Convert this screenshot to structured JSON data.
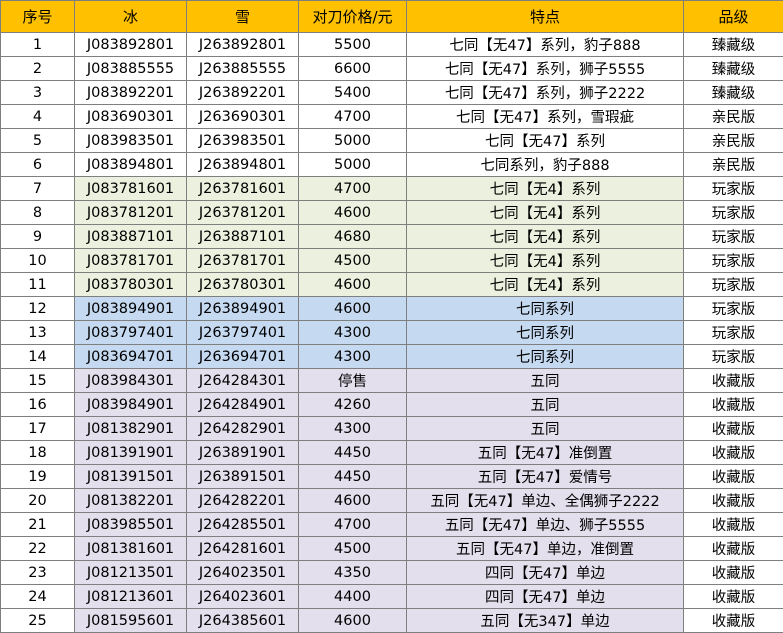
{
  "headers": [
    "序号",
    "冰",
    "雪",
    "对刀价格/元",
    "特点",
    "品级"
  ],
  "colors": {
    "header": "#ffc000",
    "default": "#ffffff",
    "green": "#ebf1de",
    "blue": "#c5d9f1",
    "purple": "#e4dfec"
  },
  "rows": [
    {
      "no": "1",
      "ice": "J083892801",
      "snow": "J263892801",
      "price": "5500",
      "feature": "七同【无47】系列，豹子888",
      "grade": "臻藏级",
      "fill": "default",
      "fill_mid": true
    },
    {
      "no": "2",
      "ice": "J083885555",
      "snow": "J263885555",
      "price": "6600",
      "feature": "七同【无47】系列，狮子5555",
      "grade": "臻藏级",
      "fill": "default",
      "fill_mid": true
    },
    {
      "no": "3",
      "ice": "J083892201",
      "snow": "J263892201",
      "price": "5400",
      "feature": "七同【无47】系列，狮子2222",
      "grade": "臻藏级",
      "fill": "default",
      "fill_mid": true
    },
    {
      "no": "4",
      "ice": "J083690301",
      "snow": "J263690301",
      "price": "4700",
      "feature": "七同【无47】系列，雪瑕疵",
      "grade": "亲民版",
      "fill": "default",
      "fill_mid": true
    },
    {
      "no": "5",
      "ice": "J083983501",
      "snow": "J263983501",
      "price": "5000",
      "feature": "七同【无47】系列",
      "grade": "亲民版",
      "fill": "default",
      "fill_mid": true
    },
    {
      "no": "6",
      "ice": "J083894801",
      "snow": "J263894801",
      "price": "5000",
      "feature": "七同系列，豹子888",
      "grade": "亲民版",
      "fill": "default",
      "fill_mid": true
    },
    {
      "no": "7",
      "ice": "J083781601",
      "snow": "J263781601",
      "price": "4700",
      "feature": "七同【无4】系列",
      "grade": "玩家版",
      "fill": "green",
      "fill_mid": true
    },
    {
      "no": "8",
      "ice": "J083781201",
      "snow": "J263781201",
      "price": "4600",
      "feature": "七同【无4】系列",
      "grade": "玩家版",
      "fill": "green",
      "fill_mid": true
    },
    {
      "no": "9",
      "ice": "J083887101",
      "snow": "J263887101",
      "price": "4680",
      "feature": "七同【无4】系列",
      "grade": "玩家版",
      "fill": "green",
      "fill_mid": true
    },
    {
      "no": "10",
      "ice": "J083781701",
      "snow": "J263781701",
      "price": "4500",
      "feature": "七同【无4】系列",
      "grade": "玩家版",
      "fill": "green",
      "fill_mid": true
    },
    {
      "no": "11",
      "ice": "J083780301",
      "snow": "J263780301",
      "price": "4600",
      "feature": "七同【无4】系列",
      "grade": "玩家版",
      "fill": "green",
      "fill_mid": true
    },
    {
      "no": "12",
      "ice": "J083894901",
      "snow": "J263894901",
      "price": "4600",
      "feature": "七同系列",
      "grade": "玩家版",
      "fill": "blue",
      "fill_mid": false
    },
    {
      "no": "13",
      "ice": "J083797401",
      "snow": "J263797401",
      "price": "4300",
      "feature": "七同系列",
      "grade": "玩家版",
      "fill": "blue",
      "fill_mid": false
    },
    {
      "no": "14",
      "ice": "J083694701",
      "snow": "J263694701",
      "price": "4300",
      "feature": "七同系列",
      "grade": "玩家版",
      "fill": "blue",
      "fill_mid": false
    },
    {
      "no": "15",
      "ice": "J083984301",
      "snow": "J264284301",
      "price": "停售",
      "feature": "五同",
      "grade": "收藏版",
      "fill": "purple",
      "fill_mid": false
    },
    {
      "no": "16",
      "ice": "J083984901",
      "snow": "J264284901",
      "price": "4260",
      "feature": "五同",
      "grade": "收藏版",
      "fill": "purple",
      "fill_mid": false
    },
    {
      "no": "17",
      "ice": "J081382901",
      "snow": "J264282901",
      "price": "4300",
      "feature": "五同",
      "grade": "收藏版",
      "fill": "purple",
      "fill_mid": false
    },
    {
      "no": "18",
      "ice": "J081391901",
      "snow": "J263891901",
      "price": "4450",
      "feature": "五同【无47】准倒置",
      "grade": "收藏版",
      "fill": "purple",
      "fill_mid": false
    },
    {
      "no": "19",
      "ice": "J081391501",
      "snow": "J263891501",
      "price": "4450",
      "feature": "五同【无47】爱情号",
      "grade": "收藏版",
      "fill": "purple",
      "fill_mid": false
    },
    {
      "no": "20",
      "ice": "J081382201",
      "snow": "J264282201",
      "price": "4600",
      "feature": "五同【无47】单边、全偶狮子2222",
      "grade": "收藏版",
      "fill": "purple",
      "fill_mid": false
    },
    {
      "no": "21",
      "ice": "J083985501",
      "snow": "J264285501",
      "price": "4700",
      "feature": "五同【无47】单边、狮子5555",
      "grade": "收藏版",
      "fill": "purple",
      "fill_mid": false
    },
    {
      "no": "22",
      "ice": "J081381601",
      "snow": "J264281601",
      "price": "4500",
      "feature": "五同【无47】单边，准倒置",
      "grade": "收藏版",
      "fill": "purple",
      "fill_mid": false
    },
    {
      "no": "23",
      "ice": "J081213501",
      "snow": "J264023501",
      "price": "4350",
      "feature": "四同【无47】单边",
      "grade": "收藏版",
      "fill": "purple",
      "fill_mid": false
    },
    {
      "no": "24",
      "ice": "J081213601",
      "snow": "J264023601",
      "price": "4400",
      "feature": "四同【无47】单边",
      "grade": "收藏版",
      "fill": "purple",
      "fill_mid": false
    },
    {
      "no": "25",
      "ice": "J081595601",
      "snow": "J264385601",
      "price": "4600",
      "feature": "五同【无347】单边",
      "grade": "收藏版",
      "fill": "purple",
      "fill_mid": false
    }
  ]
}
